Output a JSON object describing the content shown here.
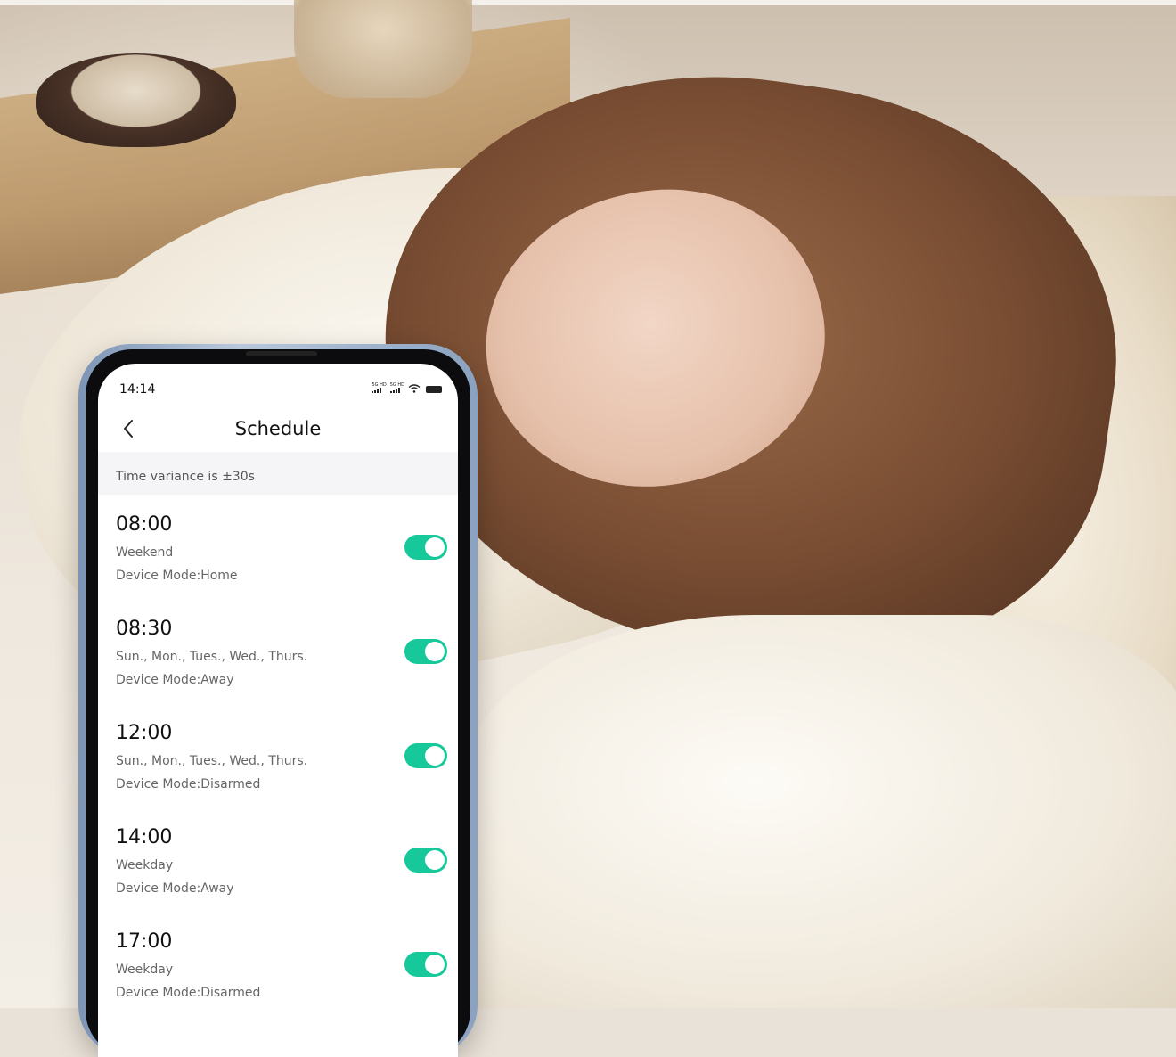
{
  "status_bar": {
    "time": "14:14",
    "signal_labels": [
      "5G HD",
      "5G HD"
    ]
  },
  "header": {
    "back_icon": "chevron-left-icon",
    "title": "Schedule"
  },
  "notice": {
    "text": "Time variance is ±30s"
  },
  "schedules": [
    {
      "time": "08:00",
      "days": "Weekend",
      "mode": "Device Mode:Home",
      "enabled": true
    },
    {
      "time": "08:30",
      "days": "Sun., Mon., Tues., Wed., Thurs.",
      "mode": "Device Mode:Away",
      "enabled": true
    },
    {
      "time": "12:00",
      "days": "Sun., Mon., Tues., Wed., Thurs.",
      "mode": "Device Mode:Disarmed",
      "enabled": true
    },
    {
      "time": "14:00",
      "days": "Weekday",
      "mode": "Device Mode:Away",
      "enabled": true
    },
    {
      "time": "17:00",
      "days": "Weekday",
      "mode": "Device Mode:Disarmed",
      "enabled": true
    }
  ],
  "colors": {
    "toggle_on": "#17c99a",
    "notice_band": "#f5f5f7",
    "phone_frame": "#9fb3cd"
  }
}
